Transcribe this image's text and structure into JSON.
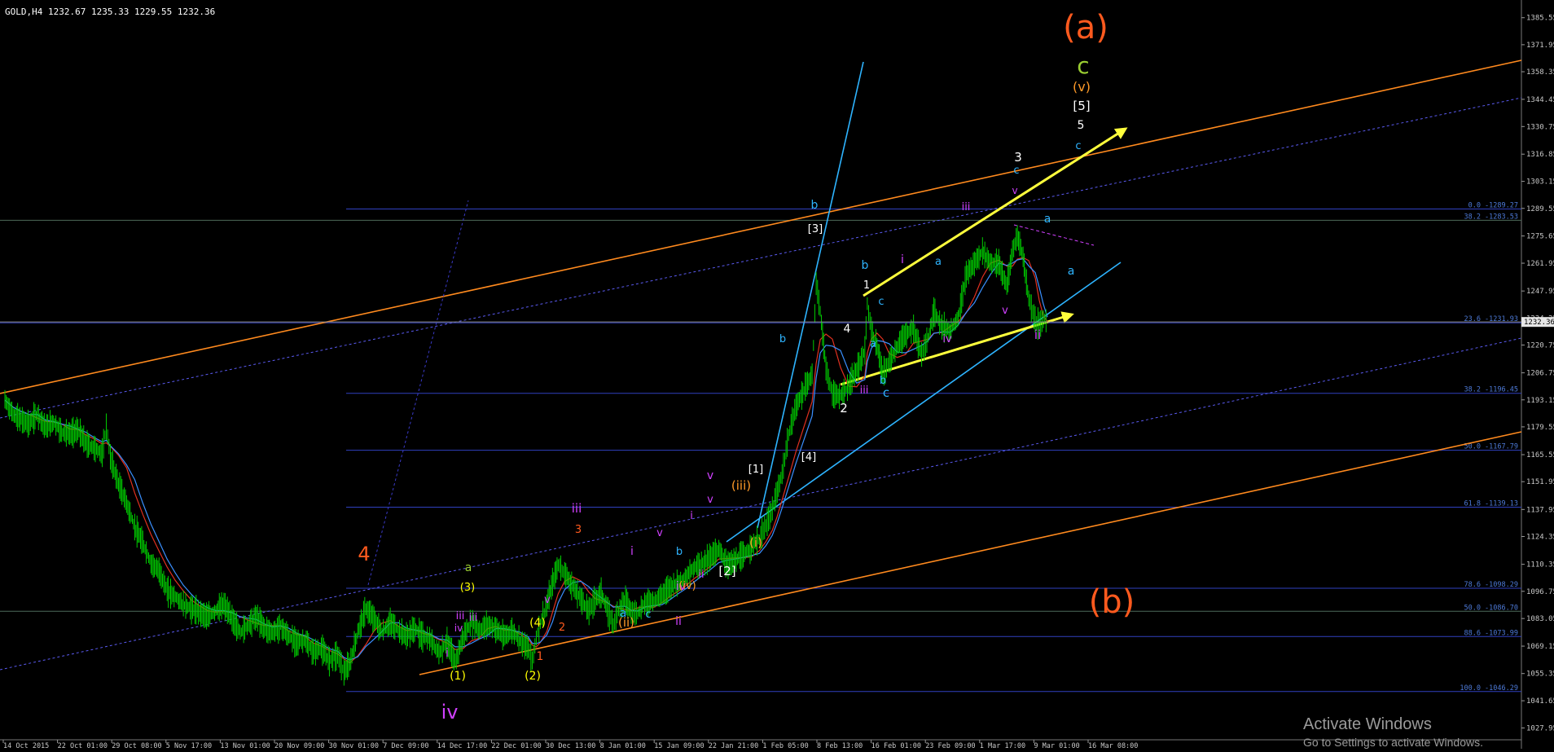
{
  "header": {
    "title": "GOLD,H4  1232.67 1235.33 1229.55 1232.36"
  },
  "chart_data": {
    "type": "candlestick",
    "symbol": "GOLD",
    "timeframe": "H4",
    "ohlc": {
      "open": 1232.67,
      "high": 1235.33,
      "low": 1229.55,
      "close": 1232.36
    },
    "last_price": 1232.36,
    "ylim": [
      1025,
      1390
    ],
    "y_ticks": [
      1385.55,
      1371.95,
      1358.35,
      1344.45,
      1330.75,
      1316.85,
      1303.15,
      1289.55,
      1275.65,
      1261.95,
      1247.95,
      1234.25,
      1220.75,
      1206.75,
      1193.15,
      1179.55,
      1165.55,
      1151.95,
      1137.95,
      1124.35,
      1110.35,
      1096.75,
      1083.05,
      1069.15,
      1055.35,
      1041.65,
      1027.95
    ],
    "x_ticks": [
      "14 Oct 2015",
      "22 Oct 01:00",
      "29 Oct 08:00",
      "5 Nov 17:00",
      "13 Nov 01:00",
      "20 Nov 09:00",
      "30 Nov 01:00",
      "7 Dec 09:00",
      "14 Dec 17:00",
      "22 Dec 01:00",
      "30 Dec 13:00",
      "8 Jan 01:00",
      "15 Jan 09:00",
      "22 Jan 21:00",
      "1 Feb 05:00",
      "8 Feb 13:00",
      "16 Feb 01:00",
      "23 Feb 09:00",
      "1 Mar 17:00",
      "9 Mar 01:00",
      "16 Mar 08:00"
    ],
    "price_path": [
      [
        0,
        1193
      ],
      [
        10,
        1186
      ],
      [
        20,
        1183
      ],
      [
        30,
        1181
      ],
      [
        40,
        1186
      ],
      [
        50,
        1179
      ],
      [
        60,
        1182
      ],
      [
        70,
        1177
      ],
      [
        80,
        1176
      ],
      [
        90,
        1178
      ],
      [
        100,
        1171
      ],
      [
        110,
        1169
      ],
      [
        120,
        1166
      ],
      [
        125,
        1180
      ],
      [
        130,
        1164
      ],
      [
        140,
        1151
      ],
      [
        150,
        1141
      ],
      [
        160,
        1129
      ],
      [
        170,
        1121
      ],
      [
        180,
        1111
      ],
      [
        190,
        1107
      ],
      [
        200,
        1097
      ],
      [
        210,
        1094
      ],
      [
        220,
        1090
      ],
      [
        230,
        1088
      ],
      [
        240,
        1086
      ],
      [
        250,
        1084
      ],
      [
        260,
        1087
      ],
      [
        270,
        1090
      ],
      [
        280,
        1083
      ],
      [
        290,
        1076
      ],
      [
        300,
        1080
      ],
      [
        310,
        1084
      ],
      [
        320,
        1078
      ],
      [
        330,
        1076
      ],
      [
        340,
        1079
      ],
      [
        350,
        1074
      ],
      [
        360,
        1071
      ],
      [
        370,
        1072
      ],
      [
        380,
        1066
      ],
      [
        390,
        1068
      ],
      [
        400,
        1062
      ],
      [
        410,
        1065
      ],
      [
        418,
        1056
      ],
      [
        425,
        1060
      ],
      [
        435,
        1076
      ],
      [
        445,
        1088
      ],
      [
        455,
        1083
      ],
      [
        465,
        1076
      ],
      [
        475,
        1081
      ],
      [
        485,
        1077
      ],
      [
        495,
        1074
      ],
      [
        505,
        1078
      ],
      [
        515,
        1074
      ],
      [
        525,
        1072
      ],
      [
        535,
        1066
      ],
      [
        545,
        1071
      ],
      [
        555,
        1061
      ],
      [
        565,
        1074
      ],
      [
        575,
        1081
      ],
      [
        585,
        1077
      ],
      [
        595,
        1080
      ],
      [
        605,
        1078
      ],
      [
        615,
        1074
      ],
      [
        625,
        1077
      ],
      [
        635,
        1072
      ],
      [
        645,
        1068
      ],
      [
        650,
        1062
      ],
      [
        655,
        1073
      ],
      [
        660,
        1081
      ],
      [
        668,
        1090
      ],
      [
        675,
        1101
      ],
      [
        682,
        1110
      ],
      [
        690,
        1106
      ],
      [
        700,
        1099
      ],
      [
        710,
        1093
      ],
      [
        720,
        1087
      ],
      [
        728,
        1093
      ],
      [
        735,
        1096
      ],
      [
        742,
        1088
      ],
      [
        750,
        1080
      ],
      [
        758,
        1089
      ],
      [
        765,
        1093
      ],
      [
        772,
        1086
      ],
      [
        780,
        1086
      ],
      [
        790,
        1091
      ],
      [
        800,
        1092
      ],
      [
        810,
        1095
      ],
      [
        820,
        1099
      ],
      [
        830,
        1101
      ],
      [
        840,
        1104
      ],
      [
        850,
        1109
      ],
      [
        860,
        1111
      ],
      [
        870,
        1114
      ],
      [
        880,
        1118
      ],
      [
        890,
        1110
      ],
      [
        900,
        1112
      ],
      [
        910,
        1115
      ],
      [
        920,
        1119
      ],
      [
        930,
        1123
      ],
      [
        938,
        1130
      ],
      [
        946,
        1138
      ],
      [
        952,
        1147
      ],
      [
        958,
        1156
      ],
      [
        966,
        1175
      ],
      [
        975,
        1190
      ],
      [
        985,
        1198
      ],
      [
        995,
        1206
      ],
      [
        1000,
        1252
      ],
      [
        1005,
        1238
      ],
      [
        1012,
        1209
      ],
      [
        1020,
        1196
      ],
      [
        1030,
        1195
      ],
      [
        1040,
        1200
      ],
      [
        1050,
        1208
      ],
      [
        1060,
        1218
      ],
      [
        1063,
        1241
      ],
      [
        1068,
        1228
      ],
      [
        1075,
        1220
      ],
      [
        1082,
        1206
      ],
      [
        1090,
        1212
      ],
      [
        1100,
        1220
      ],
      [
        1110,
        1226
      ],
      [
        1120,
        1229
      ],
      [
        1130,
        1216
      ],
      [
        1138,
        1224
      ],
      [
        1145,
        1238
      ],
      [
        1155,
        1230
      ],
      [
        1165,
        1228
      ],
      [
        1175,
        1234
      ],
      [
        1185,
        1256
      ],
      [
        1195,
        1262
      ],
      [
        1205,
        1268
      ],
      [
        1215,
        1262
      ],
      [
        1225,
        1262
      ],
      [
        1235,
        1250
      ],
      [
        1242,
        1268
      ],
      [
        1248,
        1276
      ],
      [
        1255,
        1265
      ],
      [
        1262,
        1244
      ],
      [
        1270,
        1233
      ],
      [
        1275,
        1231
      ],
      [
        1280,
        1234
      ],
      [
        1285,
        1232
      ]
    ],
    "fibonacci": [
      {
        "ratio": "0.0",
        "price": 1289.27
      },
      {
        "ratio": "38.2",
        "price": 1283.53
      },
      {
        "ratio": "23.6",
        "price": 1231.93
      },
      {
        "ratio": "38.2",
        "price": 1196.45
      },
      {
        "ratio": "50.0",
        "price": 1167.79
      },
      {
        "ratio": "61.8",
        "price": 1139.13
      },
      {
        "ratio": "78.6",
        "price": 1098.29
      },
      {
        "ratio": "50.0",
        "price": 1086.7
      },
      {
        "ratio": "88.6",
        "price": 1073.99
      },
      {
        "ratio": "100.0",
        "price": 1046.29
      }
    ],
    "wave_labels": [
      {
        "text": "(a)",
        "color": "#ff5a1e"
      },
      {
        "text": "(b)",
        "color": "#ff5a1e"
      },
      {
        "text": "c",
        "color": "#9acd32"
      },
      {
        "text": "(v)",
        "color": "#ff9a28"
      },
      {
        "text": "[5]",
        "color": "#ffffff"
      },
      {
        "text": "5",
        "color": "#ffffff"
      },
      {
        "text": "c",
        "color": "#2eb4ff"
      },
      {
        "text": "3",
        "color": "#ffffff"
      },
      {
        "text": "c",
        "color": "#2eb4ff"
      },
      {
        "text": "v",
        "color": "#d040ff"
      },
      {
        "text": "iii",
        "color": "#d040ff"
      },
      {
        "text": "a",
        "color": "#2eb4ff"
      },
      {
        "text": "a",
        "color": "#2eb4ff"
      },
      {
        "text": "i",
        "color": "#d040ff"
      },
      {
        "text": "b",
        "color": "#2eb4ff"
      },
      {
        "text": "1",
        "color": "#ffffff"
      },
      {
        "text": "c",
        "color": "#2eb4ff"
      },
      {
        "text": "b",
        "color": "#2eb4ff"
      },
      {
        "text": "[3]",
        "color": "#ffffff"
      },
      {
        "text": "v",
        "color": "#d040ff"
      },
      {
        "text": "iv",
        "color": "#d040ff"
      },
      {
        "text": "ii",
        "color": "#d040ff"
      },
      {
        "text": "4",
        "color": "#ffffff"
      },
      {
        "text": "a",
        "color": "#2eb4ff"
      },
      {
        "text": "a",
        "color": "#2eb4ff"
      },
      {
        "text": "b",
        "color": "#2eb4ff"
      },
      {
        "text": "iii",
        "color": "#d040ff"
      },
      {
        "text": "b",
        "color": "#2eb4ff"
      },
      {
        "text": "c",
        "color": "#2eb4ff"
      },
      {
        "text": "2",
        "color": "#ffffff"
      },
      {
        "text": "[4]",
        "color": "#ffffff"
      },
      {
        "text": "v",
        "color": "#d040ff"
      },
      {
        "text": "(iii)",
        "color": "#ff9a28"
      },
      {
        "text": "[1]",
        "color": "#ffffff"
      },
      {
        "text": "i",
        "color": "#d040ff"
      },
      {
        "text": "v",
        "color": "#d040ff"
      },
      {
        "text": "iii",
        "color": "#d040ff"
      },
      {
        "text": "3",
        "color": "#ff5a1e"
      },
      {
        "text": "v",
        "color": "#d040ff"
      },
      {
        "text": "b",
        "color": "#2eb4ff"
      },
      {
        "text": "i",
        "color": "#d040ff"
      },
      {
        "text": "(i)",
        "color": "#ff9a28"
      },
      {
        "text": "ii",
        "color": "#d040ff"
      },
      {
        "text": "[2]",
        "color": "#ffffff"
      },
      {
        "text": "iv",
        "color": "#d040ff"
      },
      {
        "text": "(iv)",
        "color": "#ff9a28"
      },
      {
        "text": "c",
        "color": "#2eb4ff"
      },
      {
        "text": "ii",
        "color": "#d040ff"
      },
      {
        "text": "a",
        "color": "#2eb4ff"
      },
      {
        "text": "(ii)",
        "color": "#ff9a28"
      },
      {
        "text": "4",
        "color": "#ff5a1e"
      },
      {
        "text": "a",
        "color": "#9acd32"
      },
      {
        "text": "(3)",
        "color": "#ffff00"
      },
      {
        "text": "v",
        "color": "#d040ff"
      },
      {
        "text": "iii",
        "color": "#d040ff"
      },
      {
        "text": "iii",
        "color": "#d040ff"
      },
      {
        "text": "iv",
        "color": "#d040ff"
      },
      {
        "text": "i",
        "color": "#d040ff"
      },
      {
        "text": "(1)",
        "color": "#ffff00"
      },
      {
        "text": "(2)",
        "color": "#ffff00"
      },
      {
        "text": "(4)",
        "color": "#ffff00"
      },
      {
        "text": "1",
        "color": "#ff5a1e"
      },
      {
        "text": "2",
        "color": "#ff5a1e"
      },
      {
        "text": "iv",
        "color": "#d040ff"
      },
      {
        "text": "b",
        "color": "#9acd32"
      }
    ],
    "grid": false,
    "background": "#000000",
    "candle_color": "#00cc00"
  },
  "watermark": {
    "line1": "Activate Windows",
    "line2": "Go to Settings to activate Windows."
  }
}
